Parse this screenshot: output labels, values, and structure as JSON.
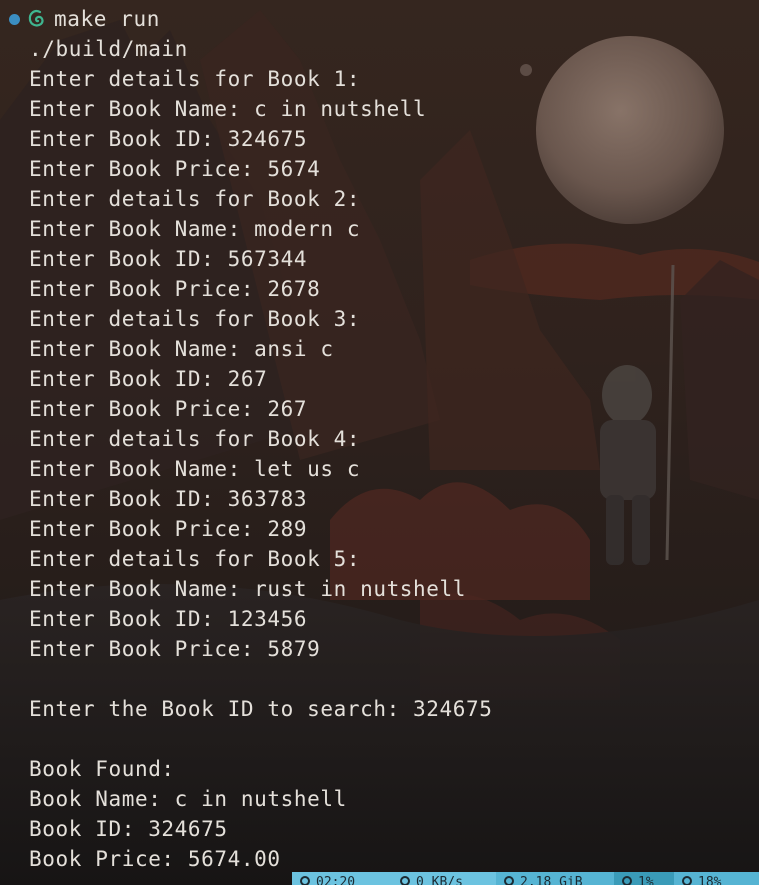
{
  "prompt": {
    "command": "make run"
  },
  "output": [
    "./build/main",
    "Enter details for Book 1:",
    "Enter Book Name: c in nutshell",
    "Enter Book ID: 324675",
    "Enter Book Price: 5674",
    "Enter details for Book 2:",
    "Enter Book Name: modern c",
    "Enter Book ID: 567344",
    "Enter Book Price: 2678",
    "Enter details for Book 3:",
    "Enter Book Name: ansi c",
    "Enter Book ID: 267",
    "Enter Book Price: 267",
    "Enter details for Book 4:",
    "Enter Book Name: let us c",
    "Enter Book ID: 363783",
    "Enter Book Price: 289",
    "Enter details for Book 5:",
    "Enter Book Name: rust in nutshell",
    "Enter Book ID: 123456",
    "Enter Book Price: 5879",
    "",
    "Enter the Book ID to search: 324675",
    "",
    "Book Found:",
    "Book Name: c in nutshell",
    "Book ID: 324675",
    "Book Price: 5674.00"
  ],
  "status_bar": {
    "segments": [
      {
        "text": "02:20",
        "icon": "clock-icon",
        "color": "#6cc3e0"
      },
      {
        "text": "0 KB/s",
        "icon": "network-icon",
        "color": "#6cc3e0"
      },
      {
        "text": "2.18 GiB",
        "icon": "memory-icon",
        "color": "#56b4d3"
      },
      {
        "text": "1%",
        "icon": "cpu-icon",
        "color": "#3a9bb8"
      },
      {
        "text": "18%",
        "icon": "disk-icon",
        "color": "#56b4d3"
      }
    ]
  },
  "colors": {
    "prompt_dot": "#3b8ec2",
    "prompt_icon": "#3fb58f",
    "text": "#e4e0da",
    "moon": "#9a8478"
  }
}
